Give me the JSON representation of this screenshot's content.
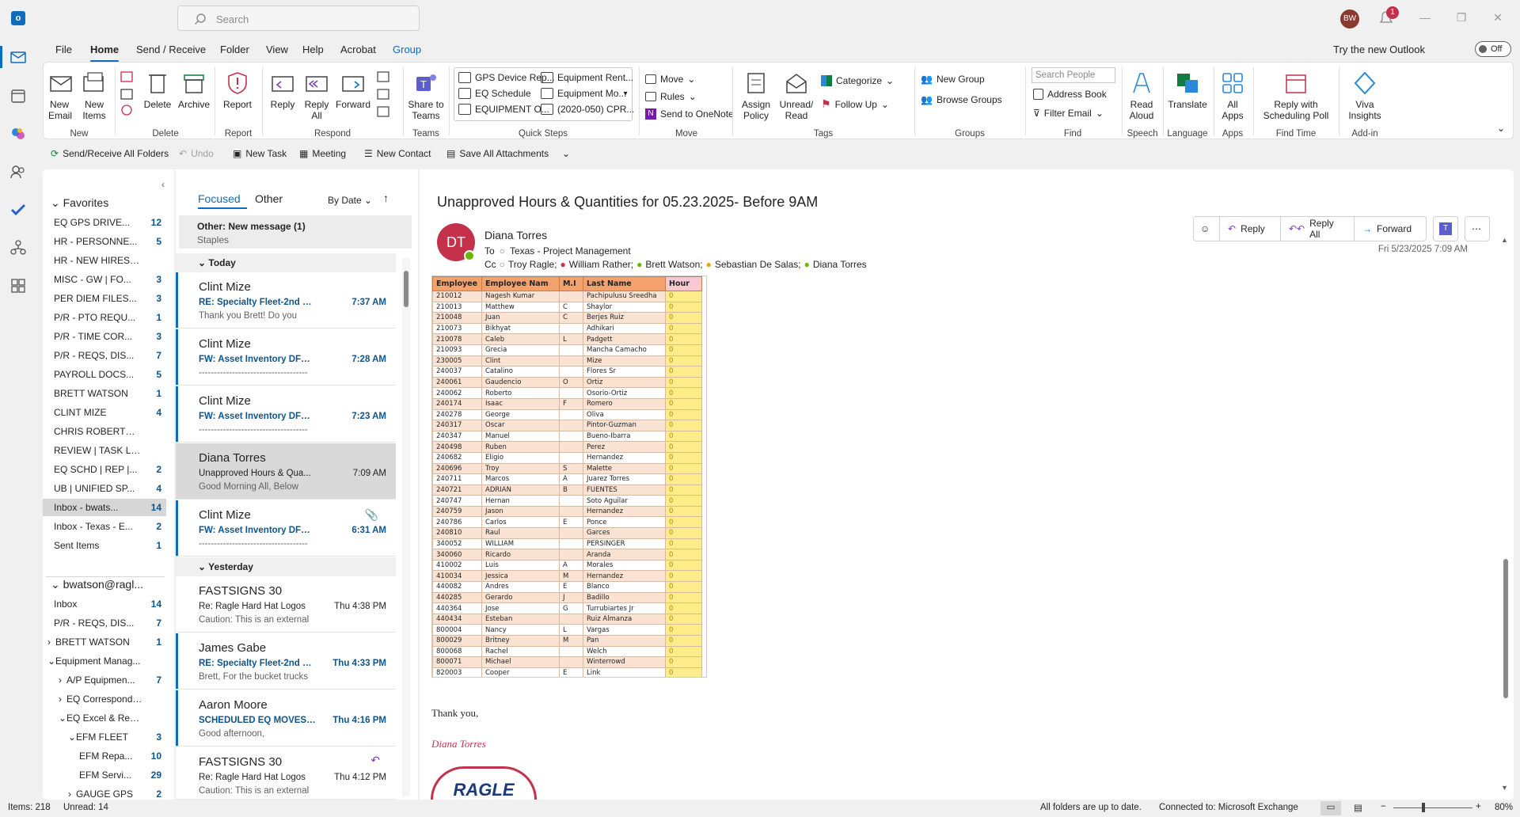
{
  "search": {
    "placeholder": "Search"
  },
  "user_initials": "BW",
  "notifications_count": "1",
  "menu": {
    "tabs": [
      "File",
      "Home",
      "Send / Receive",
      "Folder",
      "View",
      "Help",
      "Acrobat",
      "Group"
    ],
    "active": "Home",
    "try_new": "Try the new Outlook",
    "toggle_label": "Off"
  },
  "ribbon": {
    "new_email": "New Email",
    "new_items": "New Items",
    "delete": "Delete",
    "archive": "Archive",
    "report": "Report",
    "reply": "Reply",
    "reply_all": "Reply All",
    "forward": "Forward",
    "share_teams": "Share to Teams",
    "quick_steps": [
      "GPS Device Rep...",
      "Equipment Rent...",
      "EQ Schedule",
      "Equipment Mo...",
      "EQUIPMENT O...",
      "(2020-050) CPR..."
    ],
    "move": "Move",
    "rules": "Rules",
    "send_onenote": "Send to OneNote",
    "assign_policy": "Assign Policy",
    "unread_read": "Unread/ Read",
    "categorize": "Categorize",
    "follow_up": "Follow Up",
    "new_group": "New Group",
    "browse_groups": "Browse Groups",
    "search_people": "Search People",
    "address_book": "Address Book",
    "filter_email": "Filter Email",
    "read_aloud": "Read Aloud",
    "translate": "Translate",
    "all_apps": "All Apps",
    "reply_poll": "Reply with Scheduling Poll",
    "viva": "Viva Insights",
    "groups": {
      "new": "New",
      "delete": "Delete",
      "report": "Report",
      "respond": "Respond",
      "teams": "Teams",
      "quick_steps": "Quick Steps",
      "move": "Move",
      "tags": "Tags",
      "groups": "Groups",
      "find": "Find",
      "speech": "Speech",
      "language": "Language",
      "apps": "Apps",
      "find_time": "Find Time",
      "addin": "Add-in"
    }
  },
  "qat": {
    "send_receive": "Send/Receive All Folders",
    "undo": "Undo",
    "new_task": "New Task",
    "meeting": "Meeting",
    "new_contact": "New Contact",
    "save_attachments": "Save All Attachments"
  },
  "folders": {
    "favorites_label": "Favorites",
    "favorites": [
      {
        "name": "EQ GPS DRIVE...",
        "count": "12"
      },
      {
        "name": "HR - PERSONNE...",
        "count": "5"
      },
      {
        "name": "HR - NEW HIRES |...",
        "count": ""
      },
      {
        "name": "MISC - GW | FO...",
        "count": "3"
      },
      {
        "name": "PER DIEM FILES...",
        "count": "3"
      },
      {
        "name": "P/R - PTO REQU...",
        "count": "1"
      },
      {
        "name": "P/R - TIME COR...",
        "count": "3"
      },
      {
        "name": "P/R - REQS, DIS...",
        "count": "7"
      },
      {
        "name": "PAYROLL DOCS...",
        "count": "5"
      },
      {
        "name": "BRETT WATSON",
        "count": "1"
      },
      {
        "name": "CLINT MIZE",
        "count": "4"
      },
      {
        "name": "CHRIS ROBERTSON",
        "count": ""
      },
      {
        "name": "REVIEW | TASK LIST",
        "count": ""
      },
      {
        "name": "EQ SCHD | REP |...",
        "count": "2"
      },
      {
        "name": "UB | UNIFIED SP...",
        "count": "4"
      },
      {
        "name": "Inbox - bwats...",
        "count": "14"
      },
      {
        "name": "Inbox - Texas - E...",
        "count": "2"
      },
      {
        "name": "Sent Items",
        "count": "1"
      }
    ],
    "account_label": "bwatson@ragl...",
    "account": [
      {
        "name": "Inbox",
        "count": "14"
      },
      {
        "name": "P/R - REQS, DIS...",
        "count": "7"
      },
      {
        "name": "BRETT WATSON",
        "count": "1"
      },
      {
        "name": "Equipment Manag...",
        "count": ""
      },
      {
        "name": "A/P Equipmen...",
        "count": "7"
      },
      {
        "name": "EQ Corresponde...",
        "count": ""
      },
      {
        "name": "EQ Excel & Repo...",
        "count": ""
      },
      {
        "name": "EFM FLEET",
        "count": "3"
      },
      {
        "name": "EFM Repa...",
        "count": "10"
      },
      {
        "name": "EFM Servi...",
        "count": "29"
      },
      {
        "name": "GAUGE GPS",
        "count": "2"
      }
    ]
  },
  "list": {
    "tab_focused": "Focused",
    "tab_other": "Other",
    "sort": "By Date",
    "other_banner": "Other: New message (1)",
    "other_sub": "Staples",
    "today": "Today",
    "yesterday": "Yesterday",
    "messages": [
      {
        "sender": "Clint Mize",
        "subject": "RE: Specialty Fleet-2nd Buc...",
        "time": "7:37 AM",
        "preview": "Thank you Brett! Do you"
      },
      {
        "sender": "Clint Mize",
        "subject": "FW: Asset Inventory DFW ...",
        "time": "7:28 AM",
        "preview": "------------------------------------"
      },
      {
        "sender": "Clint Mize",
        "subject": "FW: Asset Inventory DFW ...",
        "time": "7:23 AM",
        "preview": "------------------------------------"
      },
      {
        "sender": "Diana Torres",
        "subject": "Unapproved Hours & Qua...",
        "time": "7:09 AM",
        "preview": "Good Morning All,  Below"
      },
      {
        "sender": "Clint Mize",
        "subject": "FW: Asset Inventory DFW ...",
        "time": "6:31 AM",
        "preview": "------------------------------------"
      },
      {
        "sender": "FASTSIGNS 30",
        "subject": "Re: Ragle Hard Hat Logos",
        "time": "Thu 4:38 PM",
        "preview": "Caution: This is an external"
      },
      {
        "sender": "James Gabe",
        "subject": "RE: Specialty Fleet-2nd Buc...",
        "time": "Thu 4:33 PM",
        "preview": "Brett,  For the bucket trucks"
      },
      {
        "sender": "Aaron Moore",
        "subject": "SCHEDULED EQ MOVES FO...",
        "time": "Thu 4:16 PM",
        "preview": "Good afternoon,"
      },
      {
        "sender": "FASTSIGNS 30",
        "subject": "Re: Ragle Hard Hat Logos",
        "time": "Thu 4:12 PM",
        "preview": "Caution: This is an external"
      }
    ]
  },
  "reading": {
    "subject": "Unapproved Hours & Quantities for 05.23.2025- Before 9AM",
    "sender_initials": "DT",
    "sender": "Diana Torres",
    "to_label": "To",
    "to": "Texas - Project Management",
    "cc_label": "Cc",
    "cc": [
      "Troy Ragle;",
      "William Rather;",
      "Brett Watson;",
      "Sebastian De Salas;",
      "Diana Torres"
    ],
    "date": "Fri 5/23/2025 7:09 AM",
    "actions": {
      "reply": "Reply",
      "reply_all": "Reply All",
      "forward": "Forward"
    },
    "thanks": "Thank you,",
    "signature": "Diana Torres",
    "logo_text": "RAGLE"
  },
  "sheet": {
    "headers": [
      "Employee",
      "Employee Nam",
      "M.I",
      "Last Name",
      "Hour"
    ],
    "rows": [
      [
        "210012",
        "Nagesh Kumar",
        "",
        "Pachipulusu Sreedha",
        "0"
      ],
      [
        "210013",
        "Matthew",
        "C",
        "Shaylor",
        "0"
      ],
      [
        "210048",
        "Juan",
        "C",
        "Berjes Ruiz",
        "0"
      ],
      [
        "210073",
        "Bikhyat",
        "",
        "Adhikari",
        "0"
      ],
      [
        "210078",
        "Caleb",
        "L",
        "Padgett",
        "0"
      ],
      [
        "210093",
        "Grecia",
        "",
        "Mancha Camacho",
        "0"
      ],
      [
        "230005",
        "Clint",
        "",
        "Mize",
        "0"
      ],
      [
        "240037",
        "Catalino",
        "",
        "Flores Sr",
        "0"
      ],
      [
        "240061",
        "Gaudencio",
        "O",
        "Ortiz",
        "0"
      ],
      [
        "240062",
        "Roberto",
        "",
        "Osorio-Ortiz",
        "0"
      ],
      [
        "240174",
        "Isaac",
        "F",
        "Romero",
        "0"
      ],
      [
        "240278",
        "George",
        "",
        "Oliva",
        "0"
      ],
      [
        "240317",
        "Oscar",
        "",
        "Pintor-Guzman",
        "0"
      ],
      [
        "240347",
        "Manuel",
        "",
        "Bueno-Ibarra",
        "0"
      ],
      [
        "240498",
        "Ruben",
        "",
        "Perez",
        "0"
      ],
      [
        "240682",
        "Eligio",
        "",
        "Hernandez",
        "0"
      ],
      [
        "240696",
        "Troy",
        "S",
        "Malette",
        "0"
      ],
      [
        "240711",
        "Marcos",
        "A",
        "Juarez Torres",
        "0"
      ],
      [
        "240721",
        "ADRIAN",
        "B",
        "FUENTES",
        "0"
      ],
      [
        "240747",
        "Hernan",
        "",
        "Soto Aguilar",
        "0"
      ],
      [
        "240759",
        "Jason",
        "",
        "Hernandez",
        "0"
      ],
      [
        "240786",
        "Carlos",
        "E",
        "Ponce",
        "0"
      ],
      [
        "240810",
        "Raul",
        "",
        "Garces",
        "0"
      ],
      [
        "340052",
        "WILLIAM",
        "",
        "PERSINGER",
        "0"
      ],
      [
        "340060",
        "Ricardo",
        "",
        "Aranda",
        "0"
      ],
      [
        "410002",
        "Luis",
        "A",
        "Morales",
        "0"
      ],
      [
        "410034",
        "Jessica",
        "M",
        "Hernandez",
        "0"
      ],
      [
        "440082",
        "Andres",
        "E",
        "Blanco",
        "0"
      ],
      [
        "440285",
        "Gerardo",
        "J",
        "Badillo",
        "0"
      ],
      [
        "440364",
        "Jose",
        "G",
        "Turrubiartes Jr",
        "0"
      ],
      [
        "440434",
        "Esteban",
        "",
        "Ruiz Almanza",
        "0"
      ],
      [
        "800004",
        "Nancy",
        "L",
        "Vargas",
        "0"
      ],
      [
        "800029",
        "Britney",
        "M",
        "Pan",
        "0"
      ],
      [
        "800068",
        "Rachel",
        "",
        "Welch",
        "0"
      ],
      [
        "800071",
        "Michael",
        "",
        "Winterrowd",
        "0"
      ],
      [
        "820003",
        "Cooper",
        "E",
        "Link",
        "0"
      ]
    ]
  },
  "status": {
    "items": "Items: 218",
    "unread": "Unread: 14",
    "uptodate": "All folders are up to date.",
    "connected": "Connected to: Microsoft Exchange",
    "zoom": "80%"
  }
}
